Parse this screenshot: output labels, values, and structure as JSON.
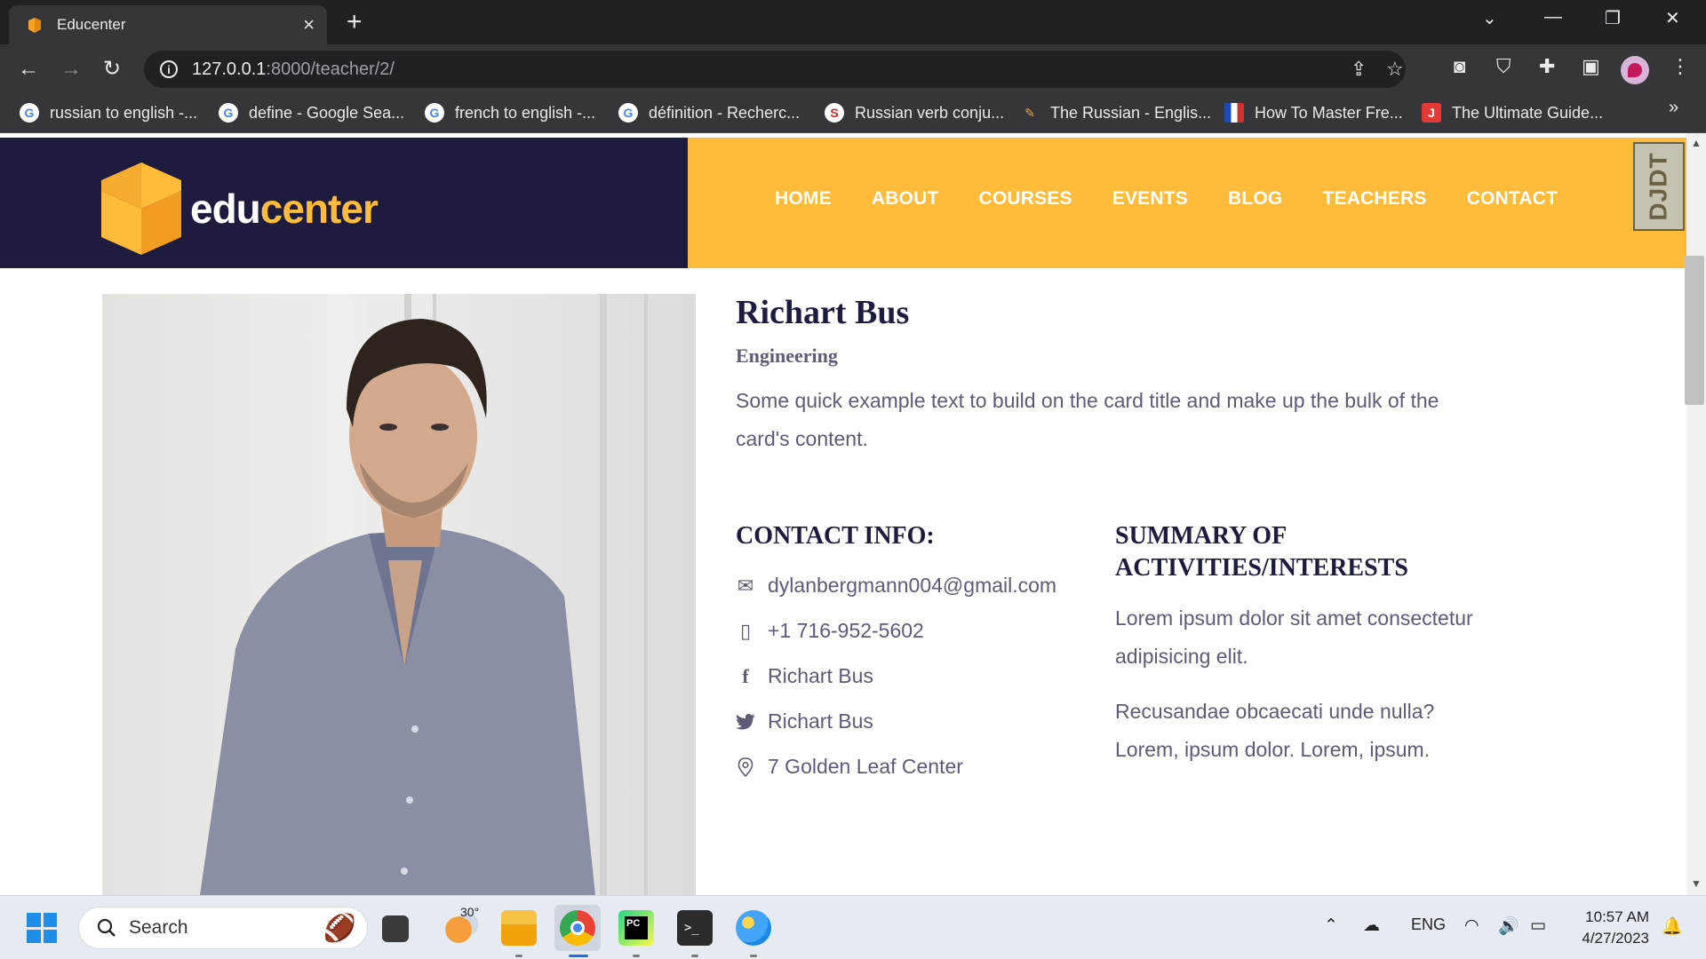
{
  "browser": {
    "tab_title": "Educenter",
    "url_host": "127.0.0.1",
    "url_path": ":8000/teacher/2/",
    "bookmarks": [
      "russian to english -...",
      "define - Google Sea...",
      "french to english -...",
      "définition - Recherc...",
      "Russian verb conju...",
      "The Russian - Englis...",
      "How To Master Fre...",
      "The Ultimate Guide..."
    ],
    "bookmarks_more": "»"
  },
  "site": {
    "logo_part1": "edu",
    "logo_part2": "center",
    "nav": [
      "HOME",
      "ABOUT",
      "COURSES",
      "EVENTS",
      "BLOG",
      "TEACHERS",
      "CONTACT"
    ],
    "debug_toolbar": "DJDT",
    "colors": {
      "navy": "#1d1b3e",
      "yellow": "#ffbc3b",
      "text": "#5c5c77"
    }
  },
  "teacher": {
    "name": "Richart Bus",
    "department": "Engineering",
    "description": "Some quick example text to build on the card title and make up the bulk of the card's content.",
    "contact_title": "CONTACT INFO:",
    "contacts": {
      "email": "dylanbergmann004@gmail.com",
      "phone": "+1 716-952-5602",
      "facebook": "Richart Bus",
      "twitter": "Richart Bus",
      "address": "7 Golden Leaf Center"
    },
    "summary_title_line1": "SUMMARY OF",
    "summary_title_line2": "ACTIVITIES/INTERESTS",
    "summary_p1": "Lorem ipsum dolor sit amet consectetur adipisicing elit.",
    "summary_p2": "Recusandae obcaecati unde nulla? Lorem, ipsum dolor. Lorem, ipsum."
  },
  "taskbar": {
    "search_label": "Search",
    "weather_temp": "30°",
    "language": "ENG",
    "time": "10:57 AM",
    "date": "4/27/2023"
  }
}
